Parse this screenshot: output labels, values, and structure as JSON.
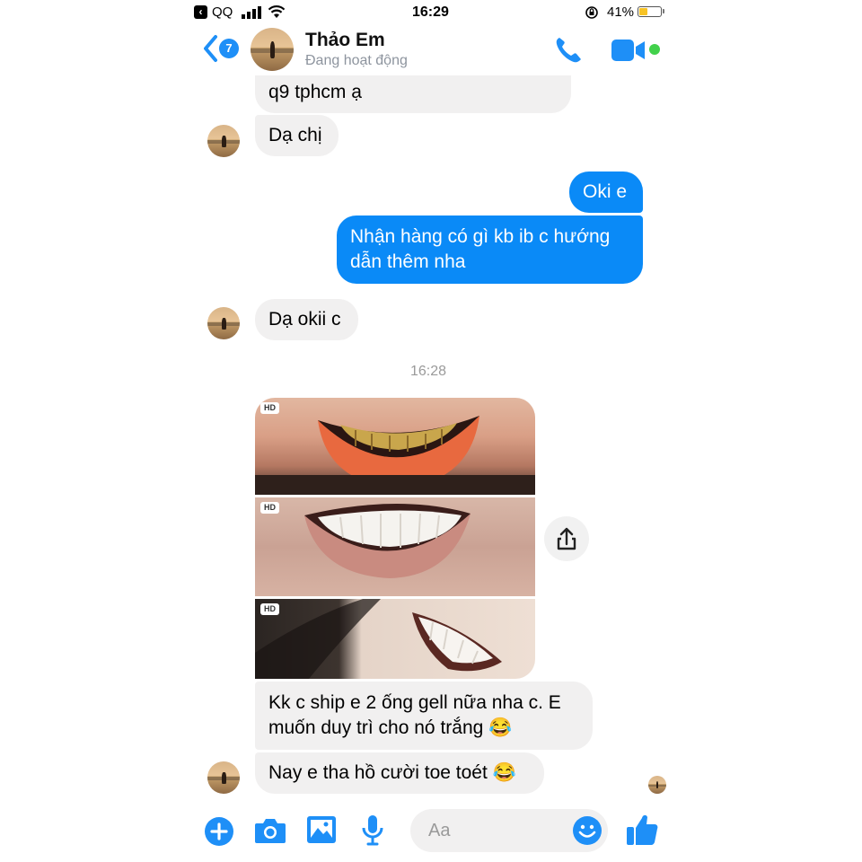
{
  "status_bar": {
    "back_app": "QQ",
    "time": "16:29",
    "battery": "41%",
    "battery_level": 0.41
  },
  "header": {
    "unread_count": "7",
    "name": "Thảo Em",
    "status": "Đang hoạt động"
  },
  "messages": [
    {
      "id": "m1",
      "side": "in",
      "text": "q9 tphcm ạ"
    },
    {
      "id": "m2",
      "side": "in",
      "text": "Dạ chị"
    },
    {
      "id": "m3",
      "side": "out",
      "text": "Oki e"
    },
    {
      "id": "m4",
      "side": "out",
      "text_line1": "Nhận hàng có gì kb ib c hướng",
      "text_line2": "dẫn thêm nha"
    },
    {
      "id": "m5",
      "side": "in",
      "text": "Dạ okii c"
    },
    {
      "id": "m6",
      "side": "in",
      "text_line1": "Kk c ship e 2 ống gell nữa nha c. E",
      "text_line2": "muốn duy trì cho nó trắng 😂"
    },
    {
      "id": "m7",
      "side": "in",
      "text": "Nay e tha hồ cười toe toét 😂"
    }
  ],
  "timestamp": "16:28",
  "photos": [
    {
      "badge": "HD",
      "icon": "teeth-before-photo"
    },
    {
      "badge": "HD",
      "icon": "teeth-after-photo"
    },
    {
      "badge": "HD",
      "icon": "smile-side-photo"
    }
  ],
  "composer": {
    "placeholder": "Aa",
    "icons": [
      "plus-icon",
      "camera-icon",
      "gallery-icon",
      "microphone-icon",
      "emoji-icon",
      "thumbs-up-icon"
    ]
  },
  "colors": {
    "accent": "#0a8af7",
    "incoming_bubble": "#f1f0f0",
    "online": "#42d14b"
  }
}
